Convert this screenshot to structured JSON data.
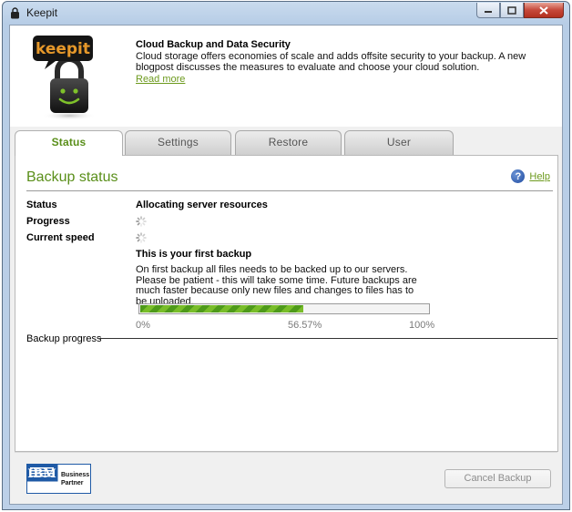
{
  "window": {
    "title": "Keepit",
    "controls": [
      "minimize",
      "maximize",
      "close"
    ]
  },
  "banner": {
    "logo_text": "keepit",
    "news_title": "Cloud Backup and Data Security",
    "news_body": "Cloud storage offers economies of scale and adds offsite security to your backup. A new blogpost discusses the measures to evaluate and choose your cloud solution.",
    "read_more": "Read more"
  },
  "tabs": [
    {
      "label": "Status",
      "active": true
    },
    {
      "label": "Settings",
      "active": false
    },
    {
      "label": "Restore",
      "active": false
    },
    {
      "label": "User",
      "active": false
    }
  ],
  "panel": {
    "title": "Backup status",
    "help_label": "Help",
    "rows": [
      {
        "label": "Status",
        "value": "Allocating server resources"
      },
      {
        "label": "Progress",
        "value": null
      },
      {
        "label": "Current speed",
        "value": null
      }
    ],
    "first_backup_title": "This is your first backup",
    "first_backup_body": "On first backup all files needs to be backed up to our servers. Please be patient - this will take some time. Future backups are much faster because only new files and changes to files has to be uploaded.",
    "progress": {
      "fraction": 0.5657,
      "min_label": "0%",
      "current_label": "56.57%",
      "max_label": "100%"
    },
    "backup_progress_label": "Backup progress"
  },
  "footer": {
    "partner_logo": {
      "brand": "IBM",
      "line1": "Business",
      "line2": "Partner"
    },
    "cancel_button": "Cancel Backup",
    "cancel_enabled": false
  },
  "colors": {
    "accent_green": "#5a8f1a",
    "link_green": "#6d9a1e",
    "progress_light": "#79bd2a",
    "progress_dark": "#4e9a1a",
    "ibm_blue": "#1f5aa6"
  }
}
